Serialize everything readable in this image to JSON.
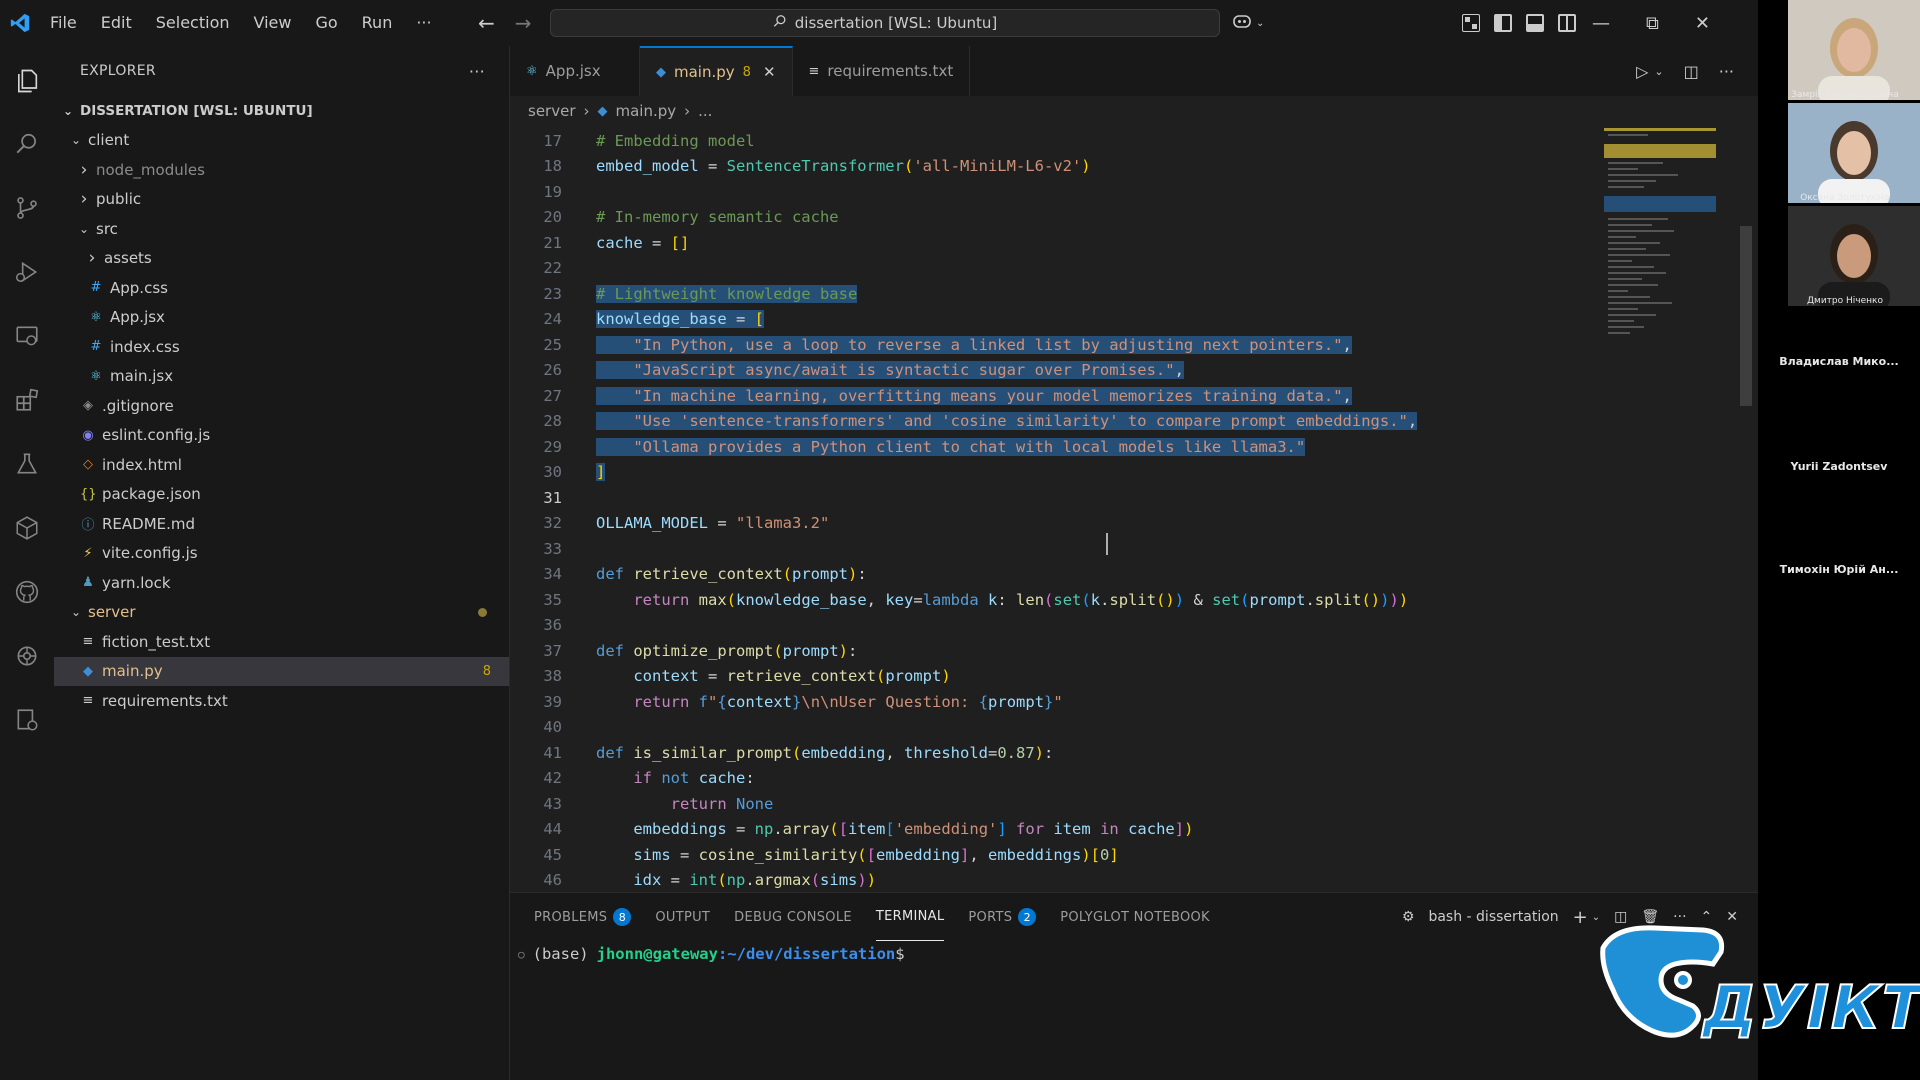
{
  "titlebar": {
    "menu": [
      "File",
      "Edit",
      "Selection",
      "View",
      "Go",
      "Run",
      "···"
    ],
    "command_center": "dissertation [WSL: Ubuntu]"
  },
  "sidebar": {
    "title": "EXPLORER",
    "more": "···",
    "root": "DISSERTATION [WSL: UBUNTU]",
    "tree": [
      {
        "label": "client",
        "indent": 1,
        "type": "folder-open"
      },
      {
        "label": "node_modules",
        "indent": 2,
        "type": "folder",
        "dim": true
      },
      {
        "label": "public",
        "indent": 2,
        "type": "folder"
      },
      {
        "label": "src",
        "indent": 2,
        "type": "folder-open"
      },
      {
        "label": "assets",
        "indent": 3,
        "type": "folder"
      },
      {
        "label": "App.css",
        "indent": 3,
        "type": "css"
      },
      {
        "label": "App.jsx",
        "indent": 3,
        "type": "react"
      },
      {
        "label": "index.css",
        "indent": 3,
        "type": "css"
      },
      {
        "label": "main.jsx",
        "indent": 3,
        "type": "react"
      },
      {
        "label": ".gitignore",
        "indent": 2,
        "type": "git"
      },
      {
        "label": "eslint.config.js",
        "indent": 2,
        "type": "eslint"
      },
      {
        "label": "index.html",
        "indent": 2,
        "type": "html"
      },
      {
        "label": "package.json",
        "indent": 2,
        "type": "json"
      },
      {
        "label": "README.md",
        "indent": 2,
        "type": "info"
      },
      {
        "label": "vite.config.js",
        "indent": 2,
        "type": "vite"
      },
      {
        "label": "yarn.lock",
        "indent": 2,
        "type": "yarn"
      },
      {
        "label": "server",
        "indent": 1,
        "type": "folder-open",
        "modified": true
      },
      {
        "label": "fiction_test.txt",
        "indent": 2,
        "type": "txt"
      },
      {
        "label": "main.py",
        "indent": 2,
        "type": "python",
        "active": true,
        "badge": "8"
      },
      {
        "label": "requirements.txt",
        "indent": 2,
        "type": "txt"
      }
    ]
  },
  "tabs": [
    {
      "label": "App.jsx",
      "icon": "react",
      "active": false
    },
    {
      "label": "main.py",
      "icon": "python",
      "active": true,
      "badge": "8",
      "close": "✕"
    },
    {
      "label": "requirements.txt",
      "icon": "txt",
      "active": false
    }
  ],
  "breadcrumb": [
    "server",
    "main.py",
    "..."
  ],
  "code": {
    "first_line": 17,
    "cursor_line": 31,
    "lines": [
      [
        [
          "cm",
          "# Embedding model"
        ]
      ],
      [
        [
          "var",
          "embed_model"
        ],
        [
          "plain",
          " = "
        ],
        [
          "cls",
          "SentenceTransformer"
        ],
        [
          "bk",
          "("
        ],
        [
          "str",
          "'all-MiniLM-L6-v2'"
        ],
        [
          "bk",
          ")"
        ]
      ],
      [],
      [
        [
          "cm",
          "# In-memory semantic cache"
        ]
      ],
      [
        [
          "var",
          "cache"
        ],
        [
          "plain",
          " = "
        ],
        [
          "bk",
          "[]"
        ]
      ],
      [],
      [
        [
          "cm",
          "# Lightweight knowledge base",
          "sel"
        ]
      ],
      [
        [
          "var",
          "knowledge_base",
          "sel"
        ],
        [
          "plain",
          " = ",
          "sel"
        ],
        [
          "bk",
          "[",
          "sel"
        ]
      ],
      [
        [
          "plain",
          "    ",
          "sel"
        ],
        [
          "str",
          "\"In Python, use a loop to reverse a linked list by adjusting next pointers.\"",
          "sel"
        ],
        [
          "plain",
          ",",
          "sel"
        ]
      ],
      [
        [
          "plain",
          "    ",
          "sel"
        ],
        [
          "str",
          "\"JavaScript async/await is syntactic sugar over Promises.\"",
          "sel"
        ],
        [
          "plain",
          ",",
          "sel"
        ]
      ],
      [
        [
          "plain",
          "    ",
          "sel"
        ],
        [
          "str",
          "\"In machine learning, overfitting means your model memorizes training data.\"",
          "sel"
        ],
        [
          "plain",
          ",",
          "sel"
        ]
      ],
      [
        [
          "plain",
          "    ",
          "sel"
        ],
        [
          "str",
          "\"Use 'sentence-transformers' and 'cosine similarity' to compare prompt embeddings.\"",
          "sel"
        ],
        [
          "plain",
          ",",
          "sel"
        ]
      ],
      [
        [
          "plain",
          "    ",
          "sel"
        ],
        [
          "str",
          "\"Ollama provides a Python client to chat with local models like llama3.\"",
          "sel"
        ]
      ],
      [
        [
          "bk",
          "]",
          "sel"
        ]
      ],
      [],
      [
        [
          "var",
          "OLLAMA_MODEL"
        ],
        [
          "plain",
          " = "
        ],
        [
          "str",
          "\"llama3.2\""
        ]
      ],
      [],
      [
        [
          "kw",
          "def"
        ],
        [
          "plain",
          " "
        ],
        [
          "fn",
          "retrieve_context"
        ],
        [
          "bk",
          "("
        ],
        [
          "var",
          "prompt"
        ],
        [
          "bk",
          ")"
        ],
        [
          "plain",
          ":"
        ]
      ],
      [
        [
          "plain",
          "    "
        ],
        [
          "kw2",
          "return"
        ],
        [
          "plain",
          " "
        ],
        [
          "fn",
          "max"
        ],
        [
          "bk",
          "("
        ],
        [
          "var",
          "knowledge_base"
        ],
        [
          "plain",
          ", "
        ],
        [
          "var",
          "key"
        ],
        [
          "plain",
          "="
        ],
        [
          "kw",
          "lambda"
        ],
        [
          "plain",
          " "
        ],
        [
          "var",
          "k"
        ],
        [
          "plain",
          ": "
        ],
        [
          "fn",
          "len"
        ],
        [
          "bk2",
          "("
        ],
        [
          "cls",
          "set"
        ],
        [
          "bk3",
          "("
        ],
        [
          "var",
          "k"
        ],
        [
          "plain",
          "."
        ],
        [
          "fn",
          "split"
        ],
        [
          "bk",
          "()"
        ],
        [
          "bk3",
          ")"
        ],
        [
          "plain",
          " & "
        ],
        [
          "cls",
          "set"
        ],
        [
          "bk3",
          "("
        ],
        [
          "var",
          "prompt"
        ],
        [
          "plain",
          "."
        ],
        [
          "fn",
          "split"
        ],
        [
          "bk",
          "()"
        ],
        [
          "bk3",
          ")"
        ],
        [
          "bk2",
          ")"
        ],
        [
          "bk",
          ")"
        ]
      ],
      [],
      [
        [
          "kw",
          "def"
        ],
        [
          "plain",
          " "
        ],
        [
          "fn",
          "optimize_prompt"
        ],
        [
          "bk",
          "("
        ],
        [
          "var",
          "prompt"
        ],
        [
          "bk",
          ")"
        ],
        [
          "plain",
          ":"
        ]
      ],
      [
        [
          "plain",
          "    "
        ],
        [
          "var",
          "context"
        ],
        [
          "plain",
          " = "
        ],
        [
          "fn",
          "retrieve_context"
        ],
        [
          "bk",
          "("
        ],
        [
          "var",
          "prompt"
        ],
        [
          "bk",
          ")"
        ]
      ],
      [
        [
          "plain",
          "    "
        ],
        [
          "kw2",
          "return"
        ],
        [
          "plain",
          " "
        ],
        [
          "kw",
          "f"
        ],
        [
          "str",
          "\""
        ],
        [
          "kw",
          "{"
        ],
        [
          "var",
          "context"
        ],
        [
          "kw",
          "}"
        ],
        [
          "str",
          "\\n\\nUser Question: "
        ],
        [
          "kw",
          "{"
        ],
        [
          "var",
          "prompt"
        ],
        [
          "kw",
          "}"
        ],
        [
          "str",
          "\""
        ]
      ],
      [],
      [
        [
          "kw",
          "def"
        ],
        [
          "plain",
          " "
        ],
        [
          "fn",
          "is_similar_prompt"
        ],
        [
          "bk",
          "("
        ],
        [
          "var",
          "embedding"
        ],
        [
          "plain",
          ", "
        ],
        [
          "var",
          "threshold"
        ],
        [
          "plain",
          "="
        ],
        [
          "num",
          "0.87"
        ],
        [
          "bk",
          ")"
        ],
        [
          "plain",
          ":"
        ]
      ],
      [
        [
          "plain",
          "    "
        ],
        [
          "kw2",
          "if"
        ],
        [
          "plain",
          " "
        ],
        [
          "kw",
          "not"
        ],
        [
          "plain",
          " "
        ],
        [
          "var",
          "cache"
        ],
        [
          "plain",
          ":"
        ]
      ],
      [
        [
          "plain",
          "        "
        ],
        [
          "kw2",
          "return"
        ],
        [
          "plain",
          " "
        ],
        [
          "kw",
          "None"
        ]
      ],
      [
        [
          "plain",
          "    "
        ],
        [
          "var",
          "embeddings"
        ],
        [
          "plain",
          " = "
        ],
        [
          "cls",
          "np"
        ],
        [
          "plain",
          "."
        ],
        [
          "fn",
          "array"
        ],
        [
          "bk",
          "("
        ],
        [
          "bk2",
          "["
        ],
        [
          "var",
          "item"
        ],
        [
          "bk3",
          "["
        ],
        [
          "str",
          "'embedding'"
        ],
        [
          "bk3",
          "]"
        ],
        [
          "plain",
          " "
        ],
        [
          "kw2",
          "for"
        ],
        [
          "plain",
          " "
        ],
        [
          "var",
          "item"
        ],
        [
          "plain",
          " "
        ],
        [
          "kw2",
          "in"
        ],
        [
          "plain",
          " "
        ],
        [
          "var",
          "cache"
        ],
        [
          "bk2",
          "]"
        ],
        [
          "bk",
          ")"
        ]
      ],
      [
        [
          "plain",
          "    "
        ],
        [
          "var",
          "sims"
        ],
        [
          "plain",
          " = "
        ],
        [
          "fn",
          "cosine_similarity"
        ],
        [
          "bk",
          "("
        ],
        [
          "bk2",
          "["
        ],
        [
          "var",
          "embedding"
        ],
        [
          "bk2",
          "]"
        ],
        [
          "plain",
          ", "
        ],
        [
          "var",
          "embeddings"
        ],
        [
          "bk",
          ")"
        ],
        [
          "bk",
          "["
        ],
        [
          "num",
          "0"
        ],
        [
          "bk",
          "]"
        ]
      ],
      [
        [
          "plain",
          "    "
        ],
        [
          "var",
          "idx"
        ],
        [
          "plain",
          " = "
        ],
        [
          "cls",
          "int"
        ],
        [
          "bk",
          "("
        ],
        [
          "cls",
          "np"
        ],
        [
          "plain",
          "."
        ],
        [
          "fn",
          "argmax"
        ],
        [
          "bk2",
          "("
        ],
        [
          "var",
          "sims"
        ],
        [
          "bk2",
          ")"
        ],
        [
          "bk",
          ")"
        ]
      ]
    ]
  },
  "panel": {
    "tabs": [
      {
        "label": "PROBLEMS",
        "badge": "8"
      },
      {
        "label": "OUTPUT"
      },
      {
        "label": "DEBUG CONSOLE"
      },
      {
        "label": "TERMINAL",
        "active": true
      },
      {
        "label": "PORTS",
        "badge": "2"
      },
      {
        "label": "POLYGLOT NOTEBOOK"
      }
    ],
    "terminal_name": "bash - dissertation",
    "terminal": {
      "env": "(base)",
      "user": "jhonn@gateway",
      "path": ":~/dev/dissertation",
      "prompt": "$"
    }
  },
  "participants": [
    {
      "name": "Замрій Ірина Сергіївна",
      "video": true,
      "bg": "#cfc9c0",
      "skin": "#e0b9a0",
      "hair": "#c9a77a"
    },
    {
      "name": "Оксана Золотухіна",
      "video": true,
      "bg": "#9ab2c8",
      "skin": "#e3c0a6",
      "hair": "#4a3a2e"
    },
    {
      "name": "Дмитро Ніченко",
      "video": true,
      "bg": "#2e2e2e",
      "skin": "#c99a7c",
      "hair": "#2a2017"
    },
    {
      "name": "Владислав Мико...",
      "video": false
    },
    {
      "name": "Yurii Zadontsev",
      "video": false
    },
    {
      "name": "Тимохін Юрій Ан...",
      "video": false
    }
  ],
  "watermark": {
    "text": "ДУІКТ"
  },
  "colors": {
    "accent": "#0078d4",
    "selection": "#264f78",
    "warning": "#cca700"
  }
}
